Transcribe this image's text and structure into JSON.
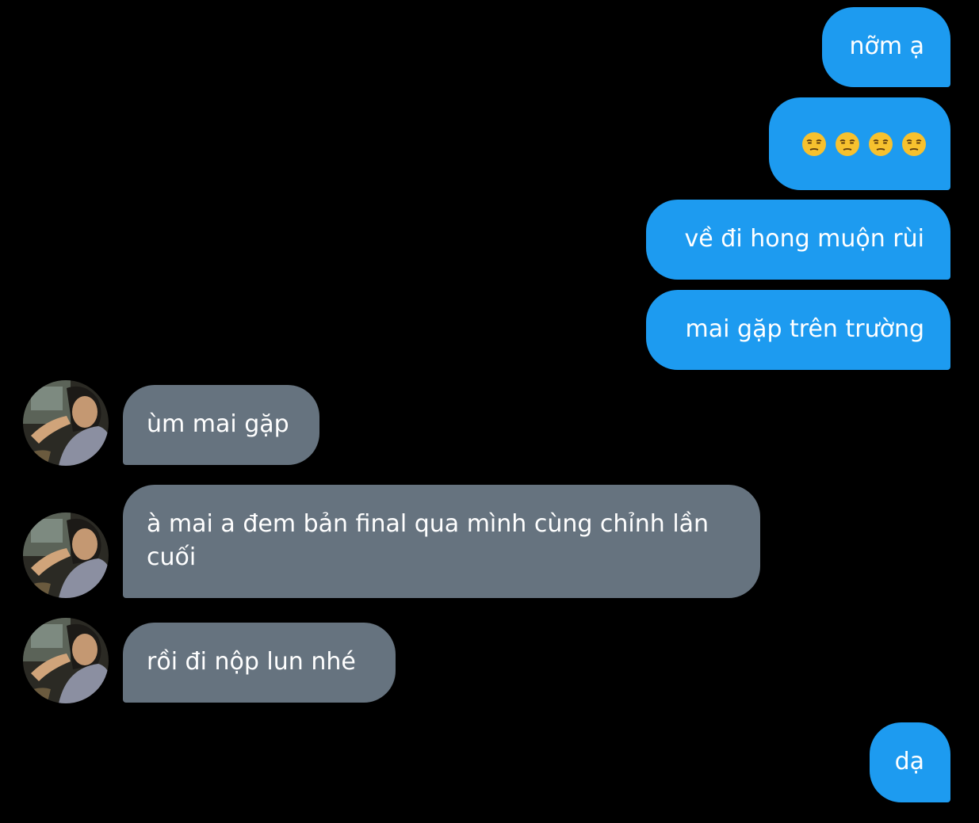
{
  "messages": {
    "m1": "nỡm ạ",
    "m2_icon": "unamused-face-emoji",
    "m2_count": 4,
    "m3": "về đi hong muộn rùi",
    "m4": "mai gặp trên trường",
    "m5": "ùm mai gặp",
    "m6": "à mai a đem bản final qua mình cùng chỉnh lần cuối",
    "m7": "rồi đi nộp lun nhé",
    "m8": "dạ"
  },
  "colors": {
    "background": "#000000",
    "outgoing_bubble": "#1d9bf0",
    "incoming_bubble": "#66737f",
    "text": "#ffffff"
  },
  "avatar": {
    "icon": "contact-avatar-photo"
  }
}
